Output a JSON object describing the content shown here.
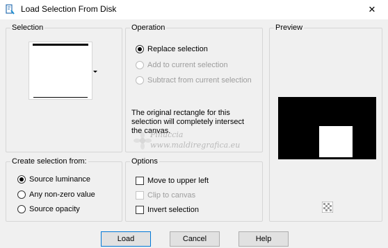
{
  "window": {
    "title": "Load Selection From Disk",
    "close_glyph": "✕"
  },
  "selection": {
    "label": "Selection"
  },
  "operation": {
    "label": "Operation",
    "options": [
      {
        "label": "Replace selection",
        "checked": true,
        "enabled": true
      },
      {
        "label": "Add to current selection",
        "checked": false,
        "enabled": false
      },
      {
        "label": "Subtract from current selection",
        "checked": false,
        "enabled": false
      }
    ],
    "info_line1": "The original rectangle for this",
    "info_line2": "selection will completely intersect",
    "info_line3": "the canvas."
  },
  "preview": {
    "label": "Preview"
  },
  "create_from": {
    "label": "Create selection from:",
    "options": [
      {
        "label": "Source luminance",
        "checked": true
      },
      {
        "label": "Any non-zero value",
        "checked": false
      },
      {
        "label": "Source opacity",
        "checked": false
      }
    ]
  },
  "options": {
    "label": "Options",
    "items": [
      {
        "label": "Move to upper left",
        "checked": false,
        "enabled": true
      },
      {
        "label": "Clip to canvas",
        "checked": false,
        "enabled": false
      },
      {
        "label": "Invert selection",
        "checked": false,
        "enabled": true
      }
    ]
  },
  "buttons": {
    "load": "Load",
    "cancel": "Cancel",
    "help": "Help"
  },
  "watermark": {
    "line1": "Pinuccia",
    "line2": "www.maldiregrafica.eu"
  },
  "colors": {
    "accent": "#0078d7",
    "preview_bg": "#000000",
    "preview_rect": "#ffffff"
  }
}
